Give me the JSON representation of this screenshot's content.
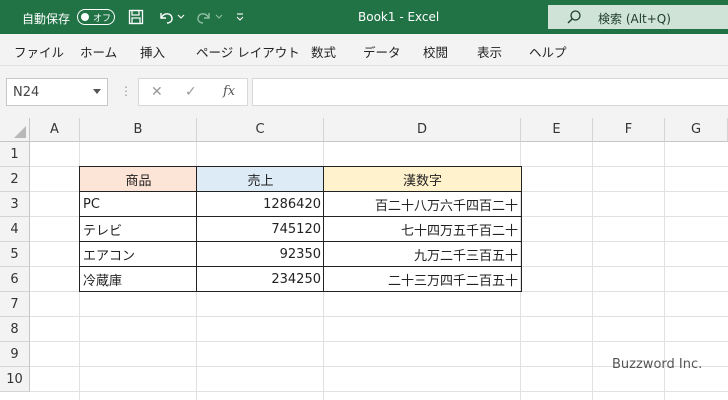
{
  "titlebar": {
    "autosave_label": "自動保存",
    "autosave_state": "オフ",
    "doc_title": "Book1  -  Excel",
    "search_label": "検索 (Alt+Q)"
  },
  "menu": [
    "ファイル",
    "ホーム",
    "挿入",
    "ページ レイアウト",
    "数式",
    "データ",
    "校閲",
    "表示",
    "ヘルプ"
  ],
  "formula_bar": {
    "name_box": "N24",
    "fx_label": "fx",
    "formula": ""
  },
  "grid": {
    "columns": [
      "A",
      "B",
      "C",
      "D",
      "E",
      "F",
      "G"
    ],
    "rows": [
      "1",
      "2",
      "3",
      "4",
      "5",
      "6",
      "7",
      "8",
      "9",
      "10"
    ]
  },
  "table": {
    "headers": [
      "商品",
      "売上",
      "漢数字"
    ],
    "header_colors": [
      "#fce4d6",
      "#ddebf7",
      "#fff2cc"
    ],
    "rows": [
      [
        "PC",
        "1286420",
        "百二十八万六千四百二十"
      ],
      [
        "テレビ",
        "745120",
        "七十四万五千百二十"
      ],
      [
        "エアコン",
        "92350",
        "九万二千三百五十"
      ],
      [
        "冷蔵庫",
        "234250",
        "二十三万四千二百五十"
      ]
    ]
  },
  "watermark": "Buzzword Inc.",
  "colors": {
    "accent": "#217346"
  }
}
